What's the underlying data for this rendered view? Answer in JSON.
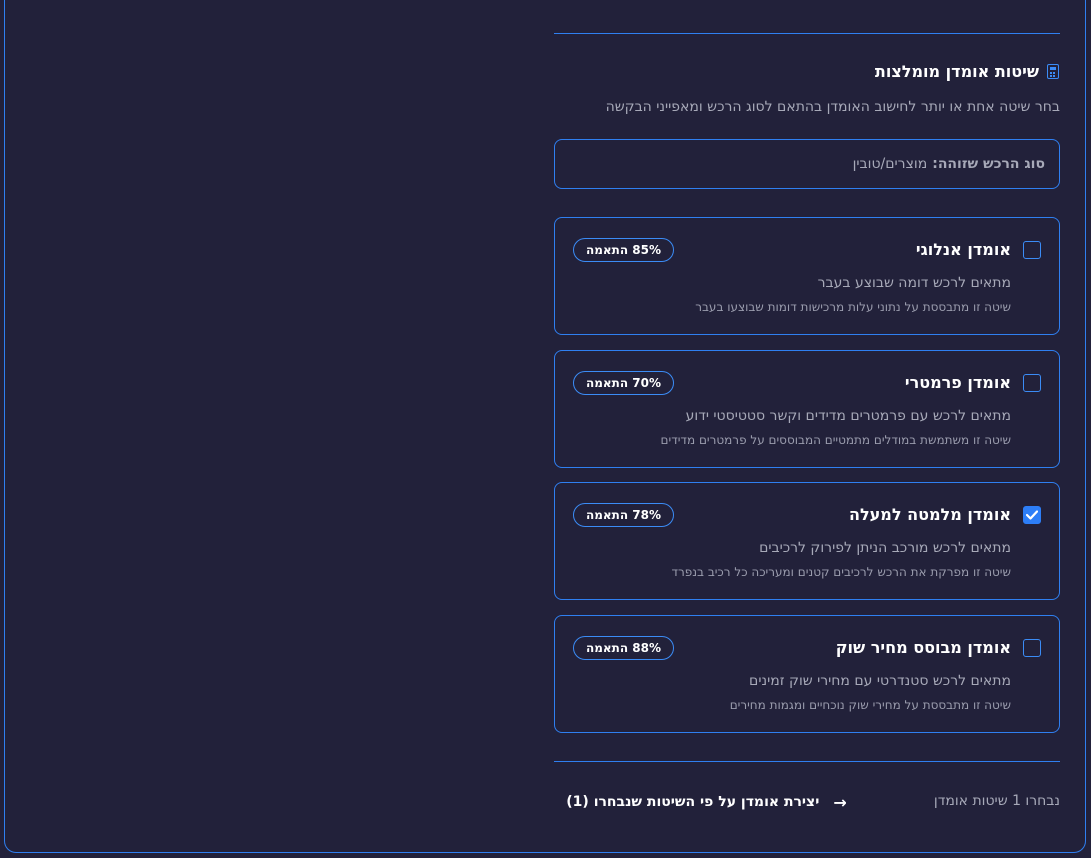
{
  "section": {
    "title": "שיטות אומדן מומלצות",
    "icon": "calculator-icon",
    "subtitle": "בחר שיטה אחת או יותר לחישוב האומדן בהתאם לסוג הרכש ומאפייני הבקשה"
  },
  "procurement_type": {
    "label": "סוג הרכש שזוהה:",
    "value": "מוצרים/טובין"
  },
  "methods": [
    {
      "title": "אומדן אנלוגי",
      "badge": "85% התאמה",
      "description": "מתאים לרכש דומה שבוצע בעבר",
      "detail": "שיטה זו מתבססת על נתוני עלות מרכישות דומות שבוצעו בעבר",
      "checked": false
    },
    {
      "title": "אומדן פרמטרי",
      "badge": "70% התאמה",
      "description": "מתאים לרכש עם פרמטרים מדידים וקשר סטטיסטי ידוע",
      "detail": "שיטה זו משתמשת במודלים מתמטיים המבוססים על פרמטרים מדידים",
      "checked": false
    },
    {
      "title": "אומדן מלמטה למעלה",
      "badge": "78% התאמה",
      "description": "מתאים לרכש מורכב הניתן לפירוק לרכיבים",
      "detail": "שיטה זו מפרקת את הרכש לרכיבים קטנים ומעריכה כל רכיב בנפרד",
      "checked": true
    },
    {
      "title": "אומדן מבוסס מחיר שוק",
      "badge": "88% התאמה",
      "description": "מתאים לרכש סטנדרטי עם מחירי שוק זמינים",
      "detail": "שיטה זו מתבססת על מחירי שוק נוכחיים ומגמות מחירים",
      "checked": false
    }
  ],
  "footer": {
    "selected_count": "נבחרו 1 שיטות אומדן",
    "create_button": "יצירת אומדן על פי השיטות שנבחרו (1)",
    "arrow_icon": "arrow-right-icon"
  },
  "colors": {
    "background": "#22213a",
    "accent": "#2f7ff0",
    "checked": "#2d7ef7",
    "muted_text": "#a7a9b8"
  }
}
